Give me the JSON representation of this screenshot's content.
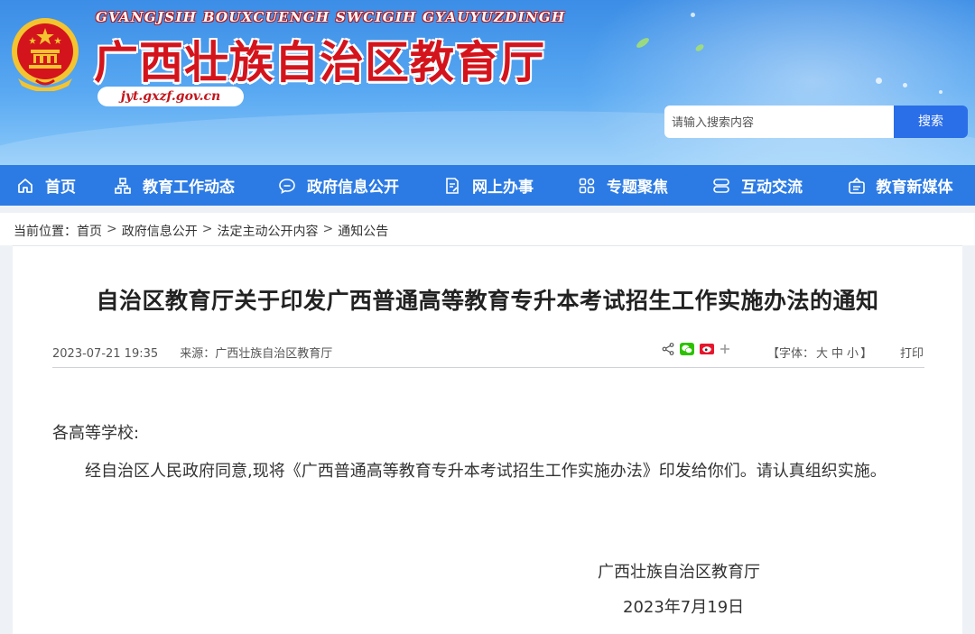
{
  "header": {
    "site_name_pinyin": "GVANGJSIH BOUXCUENGH SWCIGIH GYAUYUZDINGH",
    "site_name": "广西壮族自治区教育厅",
    "site_url": "jyt.gxzf.gov.cn",
    "search": {
      "placeholder": "请输入搜索内容",
      "button_label": "搜索"
    }
  },
  "nav": {
    "items": [
      {
        "label": "首页",
        "icon": "home-icon"
      },
      {
        "label": "教育工作动态",
        "icon": "org-chart-icon"
      },
      {
        "label": "政府信息公开",
        "icon": "chat-bubble-icon"
      },
      {
        "label": "网上办事",
        "icon": "document-edit-icon"
      },
      {
        "label": "专题聚焦",
        "icon": "grid-icon"
      },
      {
        "label": "互动交流",
        "icon": "exchange-icon"
      },
      {
        "label": "教育新媒体",
        "icon": "media-icon"
      }
    ]
  },
  "breadcrumb": {
    "prefix": "当前位置：",
    "items": [
      "首页",
      "政府信息公开",
      "法定主动公开内容",
      "通知公告"
    ],
    "separator": ">"
  },
  "article": {
    "title": "自治区教育厅关于印发广西普通高等教育专升本考试招生工作实施办法的通知",
    "datetime": "2023-07-21 19:35",
    "source": "来源：广西壮族自治区教育厅",
    "font_size": {
      "label_open": "【字体：",
      "options": [
        "大",
        "中",
        "小"
      ],
      "label_close": "】"
    },
    "print_label": "打印",
    "salutation": "各高等学校:",
    "paragraph": "经自治区人民政府同意,现将《广西普通高等教育专升本考试招生工作实施办法》印发给你们。请认真组织实施。",
    "signature_org": "广西壮族自治区教育厅",
    "signature_date": "2023年7月19日"
  },
  "share_icons": [
    "share-icon",
    "wechat-icon",
    "weibo-icon",
    "plus-icon"
  ],
  "colors": {
    "nav_bg": "#2c7be5",
    "title_red": "#d4141c",
    "search_btn": "#2a6ee8"
  }
}
